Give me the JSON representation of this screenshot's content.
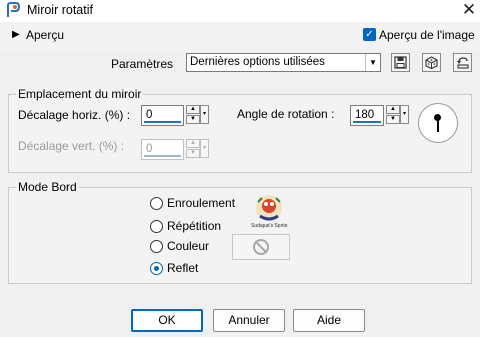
{
  "window": {
    "title": "Miroir rotatif",
    "close_glyph": "✕"
  },
  "preview": {
    "toggle_label": "Aperçu",
    "image_preview_label": "Aperçu de l'image",
    "image_preview_checked": true
  },
  "presets": {
    "label": "Paramètres",
    "selected": "Dernières options utilisées",
    "icons": [
      "save-preset-icon",
      "randomize-dice-icon",
      "reset-icon"
    ]
  },
  "mirror_location": {
    "group_title": "Emplacement du miroir",
    "horiz_offset_label": "Décalage horiz. (%) :",
    "horiz_offset_value": "0",
    "vert_offset_label": "Décalage vert. (%) :",
    "vert_offset_value": "0",
    "rotation_label": "Angle de rotation :",
    "rotation_value": "180"
  },
  "edge_mode": {
    "group_title": "Mode Bord",
    "options": [
      "Enroulement",
      "Répétition",
      "Couleur",
      "Reflet"
    ],
    "selected": "Reflet",
    "logo_text": "Sudapat's Sprite"
  },
  "buttons": {
    "ok": "OK",
    "cancel": "Annuler",
    "help": "Aide"
  },
  "colors": {
    "accent": "#0067c0",
    "background": "#f0f0f0"
  }
}
